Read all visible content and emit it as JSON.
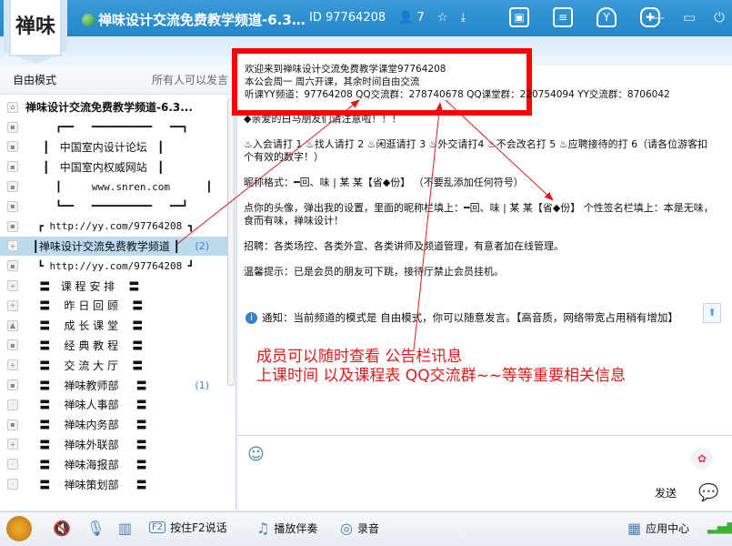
{
  "header": {
    "logo": "禅味",
    "title": "禅味设计交流免费教学频道-6.3…",
    "id_label": "ID 97764208",
    "online_count": "7"
  },
  "mode": {
    "left": "自由模式",
    "right": "所有人可以发言"
  },
  "channel_tree": [
    {
      "icon": "home",
      "text": "禅味设计交流免费教学频道-6.3...",
      "bold": true
    },
    {
      "icon": "lock",
      "text": "     ┏━━   ━━━━━━━━━━   ━━┓"
    },
    {
      "icon": "lock",
      "text": "     ┃   中国室内设计论坛   ┃",
      "cn": true
    },
    {
      "icon": "lock",
      "text": "     ┃   中国室内权威网站   ┃",
      "cn": true
    },
    {
      "icon": "lock",
      "text": "     ┃     www.snren.com      ┃"
    },
    {
      "icon": "lock",
      "text": "     ┗━━   ━━━━━━━━━━   ━━┛"
    },
    {
      "icon": "lock",
      "text": "  ┏ http://yy.com/97764208 ┓"
    },
    {
      "icon": "plus",
      "text": "  ┃禅味设计交流免费教学频道 ┃",
      "cn": true,
      "selected": true,
      "count": "(2)"
    },
    {
      "icon": "lock",
      "text": "  ┗ http://yy.com/97764208 ┛"
    },
    {
      "icon": "plus",
      "text": "    〓   课 程 安 排    〓",
      "cn": true
    },
    {
      "icon": "plus",
      "text": "    〓    昨 日 回 顾    〓",
      "cn": true
    },
    {
      "icon": "cap",
      "text": "    〓    成 长 课 堂    〓",
      "cn": true
    },
    {
      "icon": "lock",
      "text": "    〓    经 典 教 程    〓",
      "cn": true
    },
    {
      "icon": "plus",
      "text": "    〓    交 流 大 厅    〓",
      "cn": true
    },
    {
      "icon": "lock",
      "text": "    〓    禅味教师部     〓",
      "cn": true,
      "count": "(1)"
    },
    {
      "icon": "dot",
      "text": "    〓    禅味人事部     〓",
      "cn": true
    },
    {
      "icon": "lock",
      "text": "    〓    禅味内务部     〓",
      "cn": true
    },
    {
      "icon": "plus",
      "text": "    〓    禅味外联部     〓",
      "cn": true
    },
    {
      "icon": "dot",
      "text": "    〓    禅味海报部     〓",
      "cn": true
    },
    {
      "icon": "dot",
      "text": "    〓    禅味策划部     〓",
      "cn": true
    }
  ],
  "bulletin": {
    "lines": [
      "欢迎来到禅味设计交流免费教学课堂97764208",
      "本公会周一  周六开课，其余时间自由交流",
      "听课YY频道：97764208   QQ交流群：278740678 QQ课堂群：220754094   YY交流群：8706042"
    ]
  },
  "board": [
    "◆亲爱的白马朋友们请注意啦！！！",
    "♨入会请打 1 ♨找人请打 2 ♨闲逛请打 3 ♨外交请打4 ♨不会改名打 5  ♨应聘接待的打 6（请各位游客扣个有效的数字！）",
    "昵称格式：━回、味 | 某   某【省◆份】 （不要乱添加任何符号）",
    "点你的头像，弹出我的设置，里面的昵称栏填上：━回、味 | 某   某【省◆份】 个性签名栏填上：本是无味，食而有味，禅味设计！",
    "招聘：各类场控、各类外宣、各类讲师及频道管理，有意者加在线管理。",
    "温馨提示：已是会员的朋友可下跳，接待厅禁止会员挂机。"
  ],
  "notice": "通知：当前频道的模式是 自由模式，你可以随意发言。【高音质，网络带宽占用稍有增加】",
  "annotation": [
    "成员可以随时查看  公告栏讯息",
    "上课时间 以及课程表 QQ交流群~~等等重要相关信息"
  ],
  "input": {
    "send_label": "发送"
  },
  "bottom": {
    "ptt": "按住F2说话",
    "music": "播放伴奏",
    "record": "录音",
    "apps": "应用中心"
  },
  "colors": {
    "accent": "#2486c8",
    "annotation": "#e01818"
  }
}
